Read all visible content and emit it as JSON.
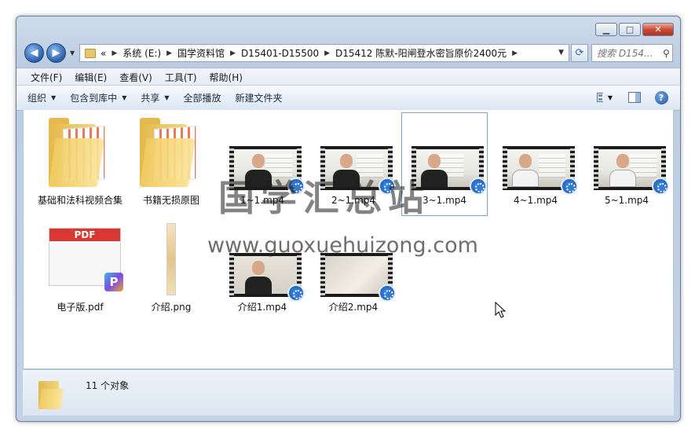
{
  "window": {
    "caption_buttons": {
      "minimize": "▁",
      "maximize": "□",
      "close": "✕"
    }
  },
  "nav": {
    "back_icon": "◀",
    "forward_icon": "▶",
    "breadcrumb": [
      {
        "label": "«"
      },
      {
        "label": "系统 (E:)"
      },
      {
        "label": "国学资料馆"
      },
      {
        "label": "D15401-D15500"
      },
      {
        "label": "D15412 陈默-阳闸登水密旨原价2400元"
      }
    ],
    "search_placeholder": "搜索 D154..."
  },
  "menubar": [
    "文件(F)",
    "编辑(E)",
    "查看(V)",
    "工具(T)",
    "帮助(H)"
  ],
  "toolbar": {
    "organize": "组织",
    "include_library": "包含到库中",
    "share": "共享",
    "play_all": "全部播放",
    "new_folder": "新建文件夹"
  },
  "files": [
    {
      "name": "基础和法科视频合集",
      "type": "folder"
    },
    {
      "name": "书籍无损原图",
      "type": "folder"
    },
    {
      "name": "1~1.mp4",
      "type": "video"
    },
    {
      "name": "2~1.mp4",
      "type": "video"
    },
    {
      "name": "3~1.mp4",
      "type": "video",
      "selected": true
    },
    {
      "name": "4~1.mp4",
      "type": "video"
    },
    {
      "name": "5~1.mp4",
      "type": "video"
    },
    {
      "name": "电子版.pdf",
      "type": "pdf"
    },
    {
      "name": "介绍.png",
      "type": "image"
    },
    {
      "name": "介绍1.mp4",
      "type": "video"
    },
    {
      "name": "介绍2.mp4",
      "type": "video"
    }
  ],
  "pdf_label": "PDF",
  "watermark": {
    "cn": "国学汇总站",
    "url": "www.guoxuehuizong.com"
  },
  "details": {
    "count_text": "11 个对象"
  },
  "colors": {
    "accent": "#2b5fa8",
    "folder": "#f0cb62",
    "pdf_red": "#d93830"
  }
}
